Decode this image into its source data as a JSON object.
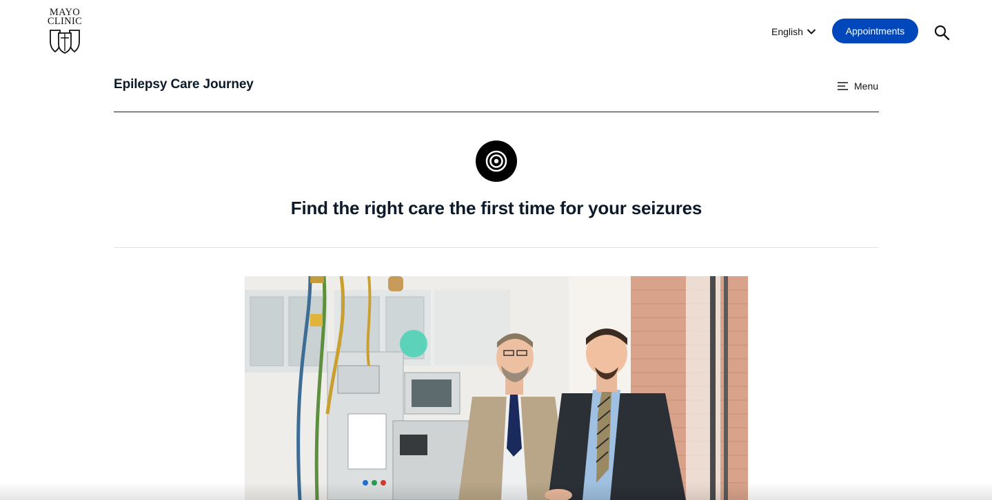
{
  "header": {
    "logo_lines": [
      "MAYO",
      "CLINIC"
    ],
    "language_label": "English",
    "appointments_label": "Appointments"
  },
  "section": {
    "title": "Epilepsy Care Journey",
    "menu_label": "Menu"
  },
  "hero": {
    "icon": "target-icon",
    "title": "Find the right care the first time for your seizures"
  },
  "photo": {
    "subject": "two-men-in-suits-in-lab"
  },
  "colors": {
    "accent": "#0047bb",
    "heading": "#0c1a2a",
    "badge": "#000000"
  },
  "icons": [
    "chevron-down-icon",
    "search-icon",
    "hamburger-icon",
    "target-icon",
    "mayo-shield-icon"
  ]
}
